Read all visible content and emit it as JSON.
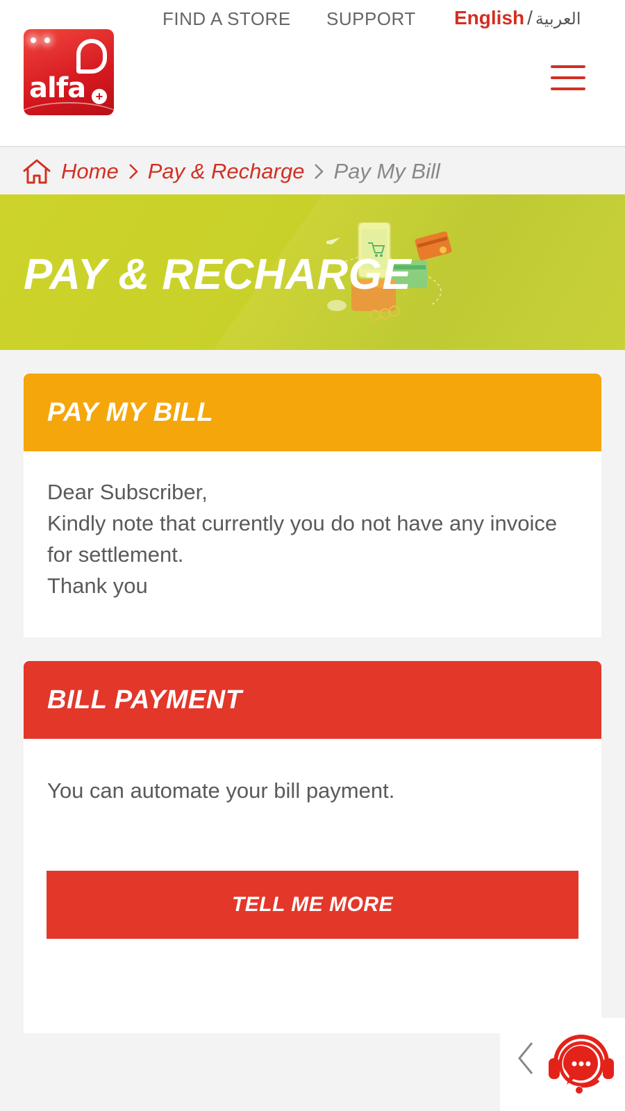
{
  "header": {
    "logo_text": "alfa",
    "nav": {
      "find_store": "FIND A STORE",
      "support": "SUPPORT"
    },
    "language": {
      "english": "English",
      "separator": "/",
      "arabic": "العربية"
    },
    "menu_icon": "hamburger-menu-icon"
  },
  "breadcrumb": {
    "home_icon": "home-icon",
    "items": [
      {
        "label": "Home"
      },
      {
        "label": "Pay & Recharge"
      },
      {
        "label": "Pay My Bill"
      }
    ]
  },
  "banner": {
    "title": "PAY & RECHARGE"
  },
  "pay_my_bill": {
    "title": "PAY MY BILL",
    "lines": [
      "Dear Subscriber,",
      "Kindly note that currently you do not have any invoice for settlement.",
      "Thank you"
    ]
  },
  "bill_payment": {
    "title": "BILL PAYMENT",
    "text": "You can automate your bill payment.",
    "button_label": "TELL ME MORE"
  },
  "chat_widget": {
    "collapse_icon": "chevron-left-icon",
    "support_icon": "headset-chat-icon"
  },
  "colors": {
    "brand_red": "#d32f23",
    "banner_green": "#c8d12a",
    "orange": "#f5a60a",
    "card_red": "#e3372a"
  }
}
